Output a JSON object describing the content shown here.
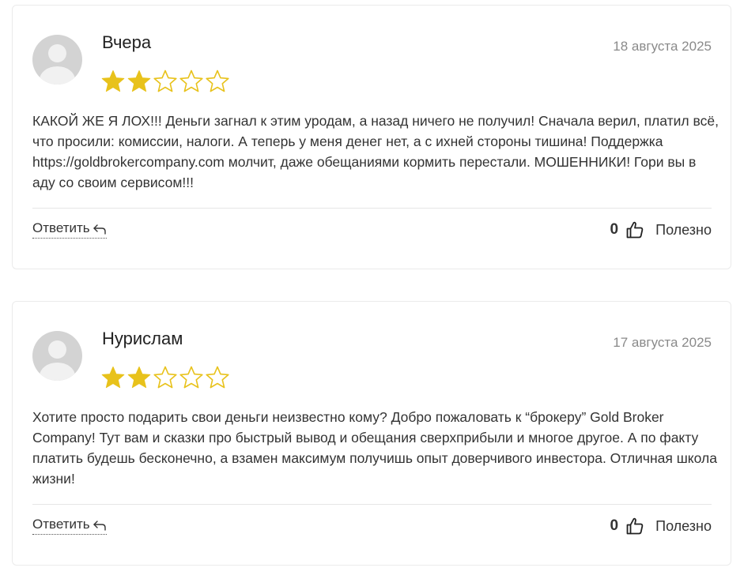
{
  "reviews": [
    {
      "author": "Вчера",
      "date": "18 августа 2025",
      "rating": 2,
      "max_rating": 5,
      "text": "КАКОЙ ЖЕ Я ЛОХ!!! Деньги загнал к этим уродам, а назад ничего не получил! Сначала верил, платил всё, что просили: комиссии, налоги. А теперь у меня денег нет, а с ихней стороны тишина! Поддержка https://goldbrokercompany.com молчит, даже обещаниями кормить перестали. МОШЕННИКИ! Гори вы в аду со своим сервисом!!!",
      "reply_label": "Ответить",
      "helpful_count": "0",
      "helpful_label": "Полезно"
    },
    {
      "author": "Нурислам",
      "date": "17 августа 2025",
      "rating": 2,
      "max_rating": 5,
      "text": "Хотите просто подарить свои деньги неизвестно кому? Добро пожаловать к “брокеру” Gold Broker Company! Тут вам и сказки про быстрый вывод и обещания сверхприбыли и многое другое. А по факту платить будешь бесконечно, а взамен максимум получишь опыт доверчивого инвестора. Отличная школа жизни!",
      "reply_label": "Ответить",
      "helpful_count": "0",
      "helpful_label": "Полезно"
    }
  ],
  "colors": {
    "star_filled": "#e8c21b",
    "star_empty_stroke": "#e8c21b",
    "date": "#8a8a8a",
    "text": "#333333"
  },
  "icons": {
    "avatar": "default-user-avatar-icon",
    "star": "star-icon",
    "reply": "reply-arrow-icon",
    "helpful": "thumbs-up-icon"
  }
}
